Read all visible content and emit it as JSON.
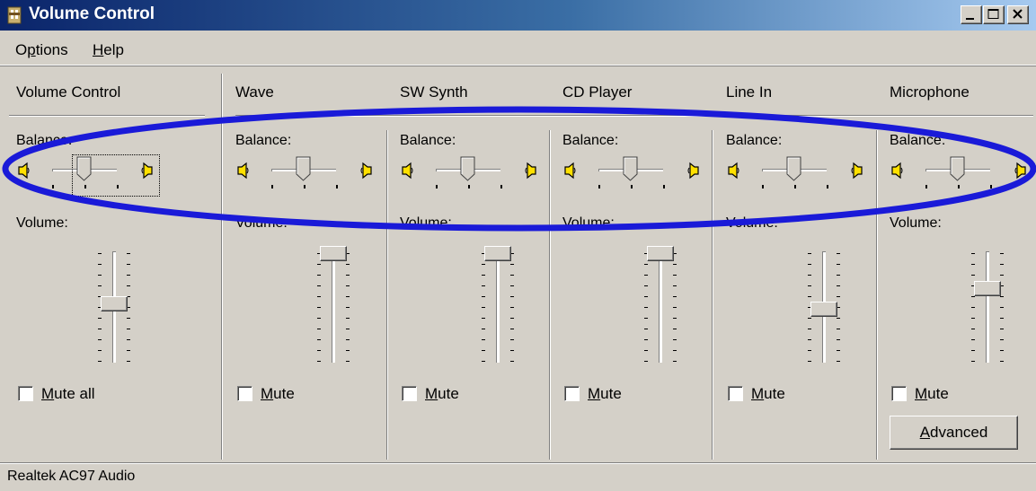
{
  "window": {
    "title": "Volume Control",
    "title_color": "#0a246a"
  },
  "menu": {
    "options_pre": "O",
    "options_u": "p",
    "options_post": "tions",
    "help_u": "H",
    "help_post": "elp"
  },
  "channels": [
    {
      "name": "Volume Control",
      "balance_label": "Balance:",
      "volume_label": "Volume:",
      "mute_u": "M",
      "mute_post": "ute all",
      "muted": false,
      "volume_level": 0.5,
      "balance": 0.5
    },
    {
      "name": "Wave",
      "balance_label": "Balance:",
      "volume_label": "Volume:",
      "mute_u": "M",
      "mute_post": "ute",
      "muted": false,
      "volume_level": 1.0,
      "balance": 0.5
    },
    {
      "name": "SW Synth",
      "balance_label": "Balance:",
      "volume_label": "Volume:",
      "mute_u": "M",
      "mute_post": "ute",
      "muted": false,
      "volume_level": 1.0,
      "balance": 0.5
    },
    {
      "name": "CD Player",
      "balance_label": "Balance:",
      "volume_label": "Volume:",
      "mute_u": "M",
      "mute_post": "ute",
      "muted": false,
      "volume_level": 1.0,
      "balance": 0.5
    },
    {
      "name": "Line In",
      "balance_label": "Balance:",
      "volume_label": "Volume:",
      "mute_u": "M",
      "mute_post": "ute",
      "muted": false,
      "volume_level": 0.45,
      "balance": 0.5
    },
    {
      "name": "Microphone",
      "balance_label": "Balance:",
      "volume_label": "Volume:",
      "mute_u": "M",
      "mute_post": "ute",
      "muted": false,
      "volume_level": 0.65,
      "balance": 0.5
    }
  ],
  "advanced_button": {
    "u": "A",
    "post": "dvanced"
  },
  "status": {
    "text": "Realtek AC97 Audio"
  },
  "annotation": {
    "color": "#1a1ad8"
  }
}
